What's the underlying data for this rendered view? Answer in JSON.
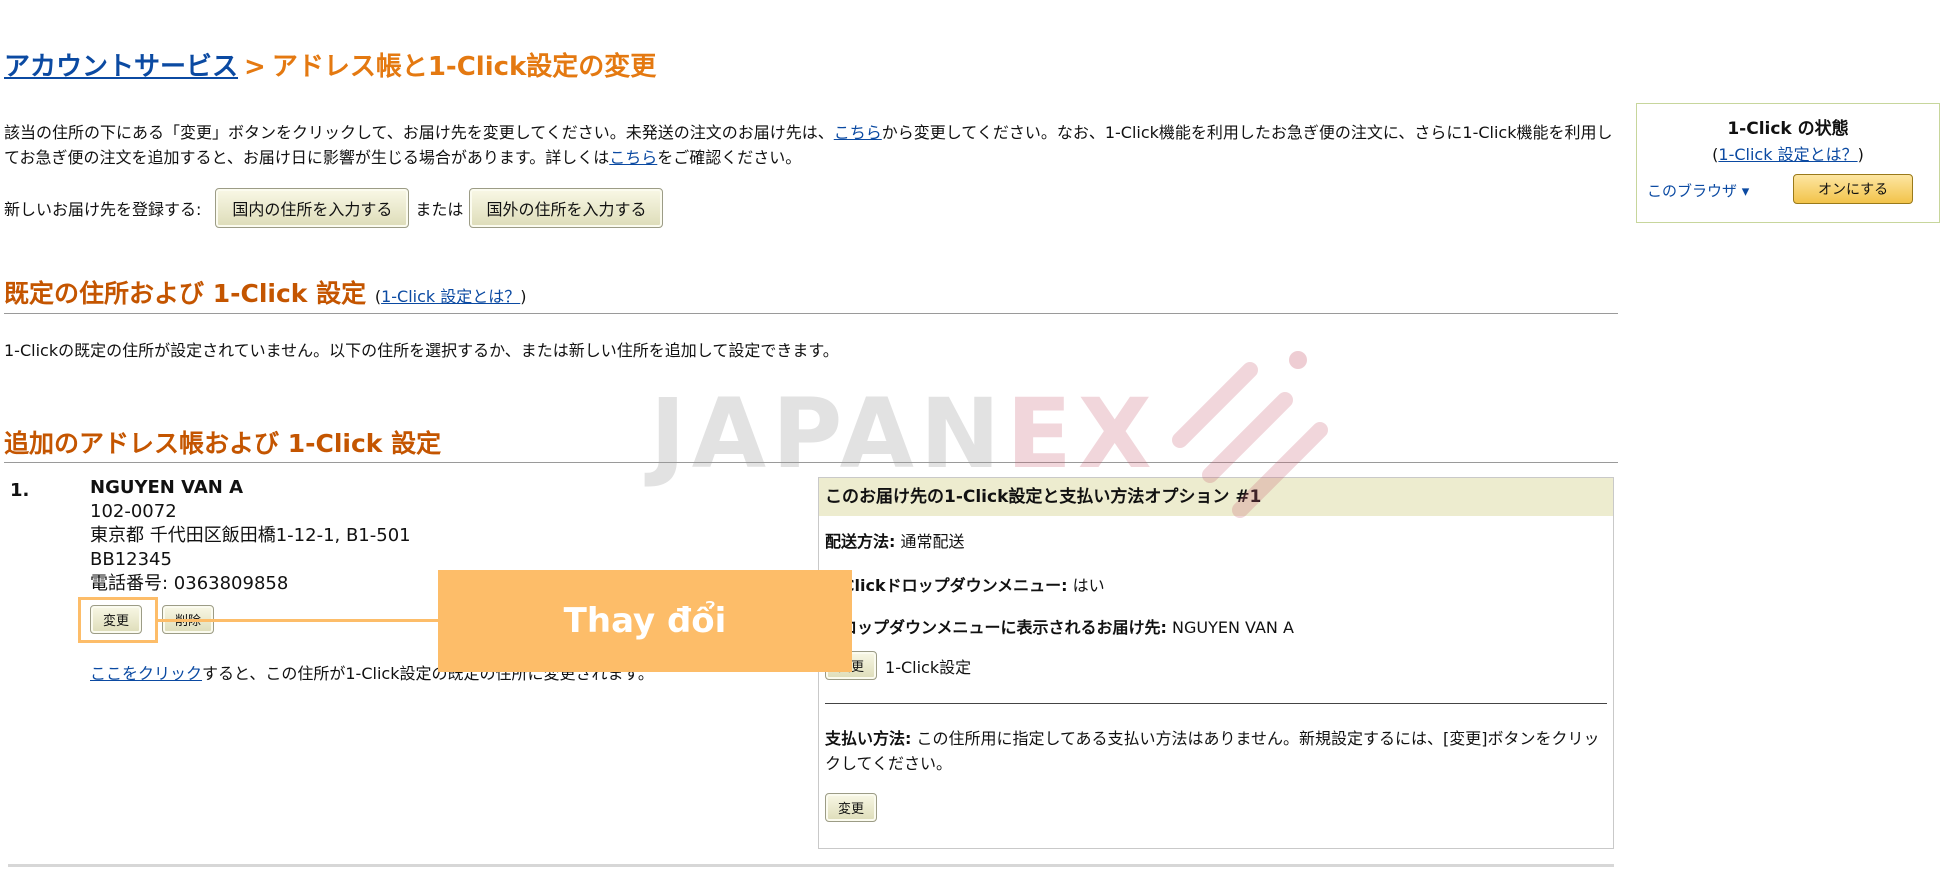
{
  "breadcrumb": {
    "home": "アカウントサービス",
    "separator": ">",
    "current": "アドレス帳と1-Click設定の変更"
  },
  "intro": {
    "part1": "該当の住所の下にある「変更」ボタンをクリックして、お届け先を変更してください。未発送の注文のお届け先は、",
    "link1": "こちら",
    "part2": "から変更してください。なお、1-Click機能を利用したお急ぎ便の注文に、さらに1-Click機能を利用してお急ぎ便の注文を追加すると、お届け日に影響が生じる場合があります。詳しくは",
    "link2": "こちら",
    "part3": "をご確認ください。"
  },
  "new_address": {
    "label": "新しいお届け先を登録する:",
    "domestic_button": "国内の住所を入力する",
    "or": "または",
    "overseas_button": "国外の住所を入力する"
  },
  "default_section": {
    "title": "既定の住所および 1-Click 設定",
    "link_text": "1-Click 設定とは？",
    "message": "1-Clickの既定の住所が設定されていません。以下の住所を選択するか、または新しい住所を追加して設定できます。"
  },
  "additional_section": {
    "title": "追加のアドレス帳および 1-Click 設定"
  },
  "address_entry": {
    "number": "1.",
    "name": "NGUYEN VAN A",
    "postal": "102-0072",
    "line1": "東京都 千代田区飯田橋1-12-1, B1-501",
    "line2": "BB12345",
    "phone": "電話番号: 0363809858",
    "edit_button": "変更",
    "delete_button": "削除",
    "click_link": "ここをクリック",
    "click_text": "すると、この住所が1-Click設定の既定の住所に変更されます。"
  },
  "panel": {
    "title": "このお届け先の1-Click設定と支払い方法オプション #1",
    "shipping_label": "配送方法:",
    "shipping_value": "通常配送",
    "dropdown_label": "1-Clickドロップダウンメニュー:",
    "dropdown_value": "はい",
    "display_label": "ドロップダウンメニューに表示されるお届け先:",
    "display_value": "NGUYEN VAN A",
    "change_button": "変更",
    "oneclick_text": "1-Click設定",
    "payment_label": "支払い方法:",
    "payment_text": "この住所用に指定してある支払い方法はありません。新規設定するには、[変更]ボタンをクリックしてください。",
    "payment_button": "変更"
  },
  "status_box": {
    "title": "1-Click の状態",
    "link": "1-Click 設定とは？",
    "browser_label": "このブラウザ ▾",
    "on_button": "オンにする"
  },
  "overlay": {
    "callout_text": "Thay đổi",
    "watermark_a": "JAPAN",
    "watermark_b": "EX"
  },
  "colors": {
    "link": "#0b4aa2",
    "heading": "#c45500",
    "callout": "#fdbd69"
  }
}
